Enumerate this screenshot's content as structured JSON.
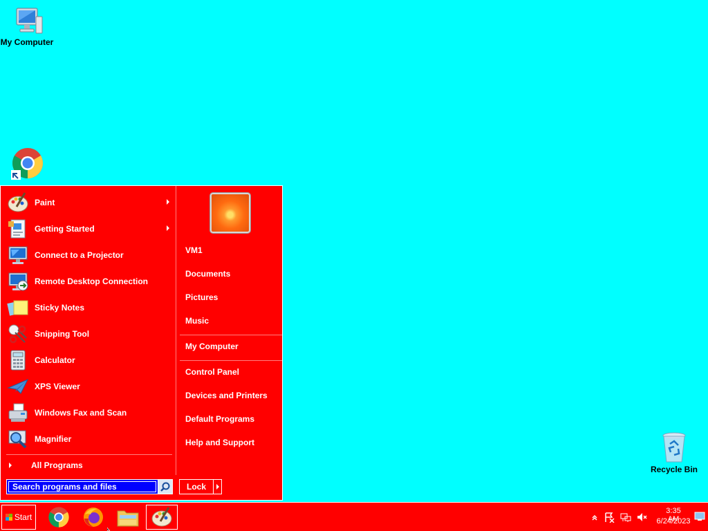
{
  "desktop": {
    "background": "#00ffff",
    "icons": [
      {
        "label": "My Computer",
        "icon": "computer-icon"
      },
      {
        "label": "Google Chrome",
        "icon": "chrome-icon"
      },
      {
        "label": "Recycle Bin",
        "icon": "recycle-bin-icon"
      }
    ]
  },
  "start_menu": {
    "background": "#ff0000",
    "programs": [
      {
        "label": "Paint",
        "icon": "paint-icon",
        "submenu": true
      },
      {
        "label": "Getting Started",
        "icon": "getting-started-icon",
        "submenu": true
      },
      {
        "label": "Connect to a Projector",
        "icon": "projector-icon",
        "submenu": false
      },
      {
        "label": "Remote Desktop Connection",
        "icon": "remote-desktop-icon",
        "submenu": false
      },
      {
        "label": "Sticky Notes",
        "icon": "sticky-notes-icon",
        "submenu": false
      },
      {
        "label": "Snipping Tool",
        "icon": "snipping-tool-icon",
        "submenu": false
      },
      {
        "label": "Calculator",
        "icon": "calculator-icon",
        "submenu": false
      },
      {
        "label": "XPS Viewer",
        "icon": "xps-viewer-icon",
        "submenu": false
      },
      {
        "label": "Windows Fax and Scan",
        "icon": "fax-scan-icon",
        "submenu": false
      },
      {
        "label": "Magnifier",
        "icon": "magnifier-icon",
        "submenu": false
      }
    ],
    "all_programs": "All Programs",
    "search_placeholder": "Search programs and files",
    "right_items": {
      "user": "VM1",
      "documents": "Documents",
      "pictures": "Pictures",
      "music": "Music",
      "my_computer": "My Computer",
      "control_panel": "Control Panel",
      "devices_printers": "Devices and Printers",
      "default_programs": "Default Programs",
      "help_support": "Help and Support"
    },
    "lock_label": "Lock"
  },
  "taskbar": {
    "background": "#ff0000",
    "start_label": "Start",
    "apps": [
      {
        "name": "Google Chrome",
        "icon": "chrome-icon"
      },
      {
        "name": "Firefox",
        "icon": "firefox-icon"
      },
      {
        "name": "Windows Explorer",
        "icon": "explorer-icon"
      },
      {
        "name": "Paint",
        "icon": "paint-icon",
        "active": true
      }
    ],
    "tray": {
      "time": "3:35 AM",
      "date": "6/24/2023",
      "icons": [
        "show-hidden-icon",
        "action-center-icon",
        "network-icon",
        "volume-muted-icon"
      ]
    }
  }
}
